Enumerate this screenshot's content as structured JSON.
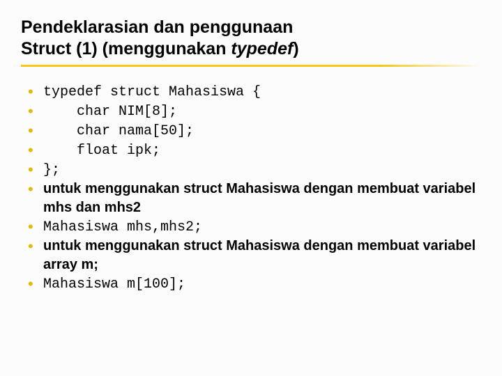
{
  "title_line1": "Pendeklarasian dan penggunaan",
  "title_line2a": "Struct (1) (menggunakan ",
  "title_line2b": "typedef",
  "title_line2c": ")",
  "lines": {
    "l1": "typedef struct Mahasiswa {",
    "l2": "    char NIM[8];",
    "l3": "    char nama[50];",
    "l4": "    float ipk;",
    "l5": "};",
    "l6": "untuk menggunakan struct Mahasiswa dengan membuat variabel mhs dan mhs2",
    "l7": "Mahasiswa mhs,mhs2;",
    "l8": "untuk menggunakan struct Mahasiswa dengan membuat variabel array m;",
    "l9": "Mahasiswa m[100];"
  }
}
